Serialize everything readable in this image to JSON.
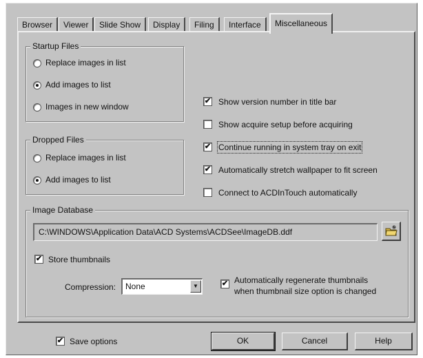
{
  "tabs": [
    {
      "label": "Browser"
    },
    {
      "label": "Viewer"
    },
    {
      "label": "Slide Show"
    },
    {
      "label": "Display"
    },
    {
      "label": "Filing"
    },
    {
      "label": "Interface"
    },
    {
      "label": "Miscellaneous"
    }
  ],
  "active_tab": "Miscellaneous",
  "startup_files": {
    "title": "Startup Files",
    "options": [
      {
        "label": "Replace images in list",
        "selected": false
      },
      {
        "label": "Add images to list",
        "selected": true
      },
      {
        "label": "Images in new window",
        "selected": false
      }
    ]
  },
  "dropped_files": {
    "title": "Dropped Files",
    "options": [
      {
        "label": "Replace images in list",
        "selected": false
      },
      {
        "label": "Add images to list",
        "selected": true
      }
    ]
  },
  "checkboxes": [
    {
      "label": "Show version number in title bar",
      "checked": true
    },
    {
      "label": "Show acquire setup before acquiring",
      "checked": false
    },
    {
      "label": "Continue running in system tray on exit",
      "checked": true
    },
    {
      "label": "Automatically stretch wallpaper to fit screen",
      "checked": true
    },
    {
      "label": "Connect to ACDInTouch automatically",
      "checked": false
    }
  ],
  "image_database": {
    "title": "Image Database",
    "path": "C:\\WINDOWS\\Application Data\\ACD Systems\\ACDSee\\ImageDB.ddf",
    "store_thumbnails": {
      "label": "Store thumbnails",
      "checked": true
    },
    "compression": {
      "label": "Compression:",
      "value": "None"
    },
    "auto_regenerate": {
      "line1": "Automatically regenerate thumbnails",
      "line2": "when thumbnail size option is changed",
      "checked": true
    }
  },
  "footer": {
    "save_options": {
      "label": "Save options",
      "checked": true
    },
    "ok_label": "OK",
    "cancel_label": "Cancel",
    "help_label": "Help"
  },
  "icons": {
    "browse": "folder-browse-icon",
    "dropdown": "chevron-down-icon",
    "check_mark": "✔"
  }
}
